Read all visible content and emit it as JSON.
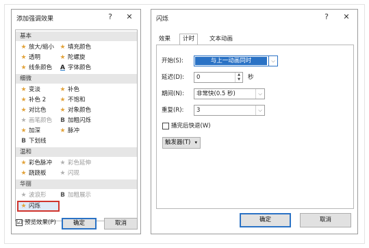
{
  "left": {
    "title": "添加强调效果",
    "help": "?",
    "close": "✕",
    "categories": {
      "basic": "基本",
      "subtle": "细微",
      "moderate": "温和",
      "exciting": "华丽"
    },
    "basic_items": [
      "放大/缩小",
      "填充颜色",
      "透明",
      "陀螺旋",
      "线条颜色",
      "字体颜色"
    ],
    "subtle_items": [
      "变淡",
      "补色",
      "补色 2",
      "不饱和",
      "对比色",
      "对象颜色",
      "画笔颜色",
      "加粗闪烁",
      "加深",
      "脉冲",
      "下划线"
    ],
    "moderate_items": [
      "彩色脉冲",
      "彩色延伸",
      "跷跷板",
      "闪现"
    ],
    "exciting_items": [
      "波浪形",
      "加粗展示",
      "闪烁"
    ],
    "glyph_b": "B",
    "glyph_a": "A",
    "preview_label": "预览效果(P)",
    "preview_check": "☑",
    "ok": "确定",
    "cancel": "取消"
  },
  "right": {
    "title": "闪烁",
    "help": "?",
    "close": "✕",
    "tabs": [
      "效果",
      "计时",
      "文本动画"
    ],
    "start_label": "开始(S):",
    "start_value": "与上一动画同时",
    "delay_label": "延迟(D):",
    "delay_value": "0",
    "delay_unit": "秒",
    "duration_label": "期间(N):",
    "duration_value": "非常快(0.5 秒)",
    "repeat_label": "重复(R):",
    "repeat_value": "3",
    "rewind_label": "播完后快退(W)",
    "trigger_label": "触发器(T)",
    "ok": "确定",
    "cancel": "取消"
  },
  "colors": {
    "accent": "#2a72c5",
    "star": "#e2a33b",
    "highlight_border": "#d0342c"
  }
}
